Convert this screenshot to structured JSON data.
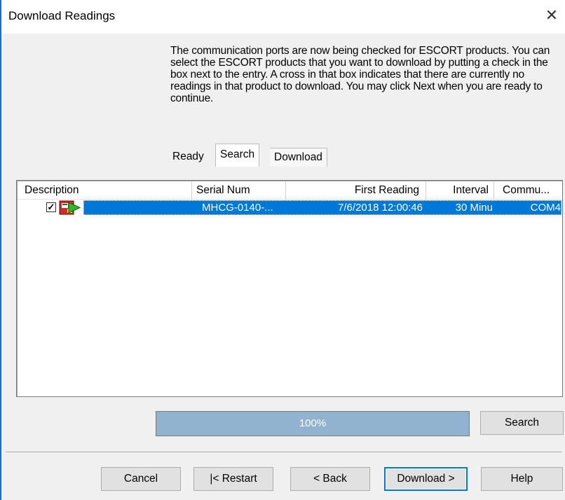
{
  "window": {
    "title": "Download Readings",
    "close_glyph": "✕"
  },
  "instructions": "The communication ports are now being checked for ESCORT products. You can select the ESCORT products that you want to download by putting a check in the box next to the entry. A cross in that box indicates that there are currently no readings in that product to download. You may click Next when you are ready to continue.",
  "tabs": [
    {
      "label": "Ready",
      "active": false
    },
    {
      "label": "Search",
      "active": true
    },
    {
      "label": "Download",
      "active": false
    }
  ],
  "table": {
    "columns": [
      "Description",
      "Serial Num",
      "First Reading",
      "Interval",
      "Commu..."
    ],
    "rows": [
      {
        "checked": true,
        "check_glyph": "✓",
        "icon": "escort-device-icon",
        "serial": "MHCG-0140-...",
        "first_reading": "7/6/2018  12:00:46",
        "interval": "30 Minu",
        "comm": "COM4",
        "selected": true
      }
    ]
  },
  "progress": {
    "value": 1.0,
    "label": "100%"
  },
  "buttons": {
    "search": "Search",
    "cancel": "Cancel",
    "restart": "|< Restart",
    "back": "< Back",
    "download": "Download >",
    "help": "Help"
  },
  "colors": {
    "selection": "#0078d7",
    "progress_fill": "#92b3cf",
    "default_button_border": "#0078d7"
  }
}
